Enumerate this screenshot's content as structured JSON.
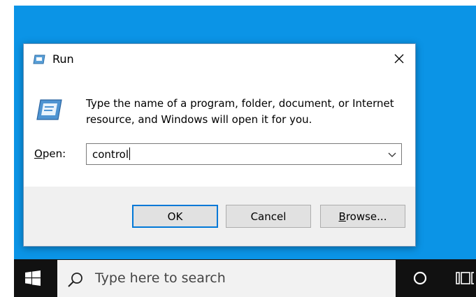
{
  "dialog": {
    "title": "Run",
    "description": "Type the name of a program, folder, document, or Internet resource, and Windows will open it for you.",
    "open_label_prefix": "",
    "open_label_accel": "O",
    "open_label_rest": "pen:",
    "input_value": "control",
    "ok_label": "OK",
    "cancel_label": "Cancel",
    "browse_accel": "B",
    "browse_rest": "rowse..."
  },
  "taskbar": {
    "search_placeholder": "Type here to search"
  },
  "colors": {
    "desktop": "#0b94e6",
    "taskbar": "#111111",
    "accent": "#0078d7"
  },
  "icons": [
    "run-icon",
    "close-icon",
    "chevron-down-icon",
    "windows-logo-icon",
    "search-icon",
    "cortana-circle-icon",
    "task-view-icon"
  ]
}
